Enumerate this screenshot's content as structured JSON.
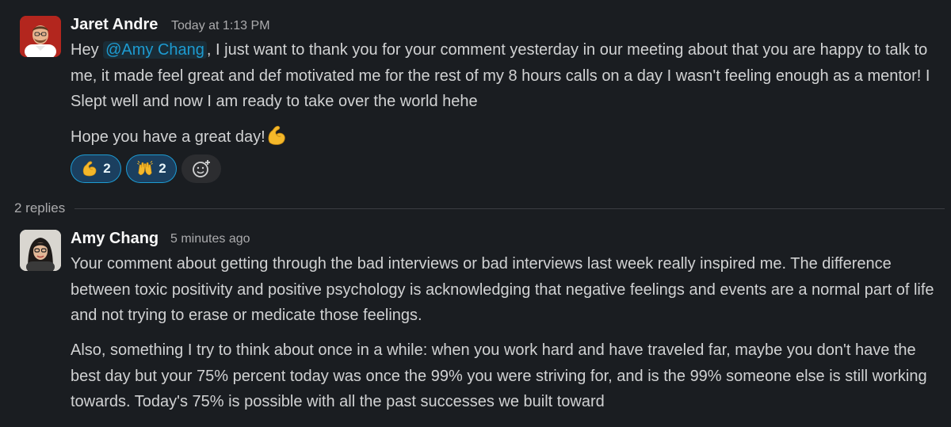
{
  "thread": {
    "parent": {
      "sender": "Jaret Andre",
      "timestamp": "Today at 1:13 PM",
      "avatar_icon": "user-avatar-man",
      "body": {
        "greeting": "Hey ",
        "mention": "@Amy Chang",
        "line1": ", I just want to thank you for your comment yesterday in our meeting about that you are happy to talk to me, it made feel great and def motivated me for the rest of my 8 hours calls on a day I wasn't feeling enough as a mentor! I Slept well and now I am ready to take over the world hehe",
        "line2": "Hope you have a great day!",
        "line2_emoji": "flexed-biceps"
      },
      "reactions": [
        {
          "emoji": "flexed-biceps",
          "count": "2"
        },
        {
          "emoji": "raising-hands",
          "count": "2"
        }
      ],
      "add_reaction_icon": "add-reaction-icon"
    },
    "replies_label": "2 replies",
    "reply": {
      "sender": "Amy Chang",
      "timestamp": "5 minutes ago",
      "avatar_icon": "user-avatar-woman",
      "paragraph1": "Your comment about getting through the bad interviews or bad interviews last week really inspired me. The difference between toxic positivity and positive psychology is acknowledging that negative feelings and events are a normal part of life and not trying to erase or medicate those feelings.",
      "paragraph2": "Also, something I try to think about once in a while: when you work hard and have traveled far, maybe you don't have the best day but your 75% percent today was once the 99% you were striving for, and is the 99% someone else is still working towards. Today's 75% is possible with all the past successes we built toward"
    }
  },
  "colors": {
    "background": "#1a1d21",
    "text": "#d1d2d3",
    "name": "#f8f8f8",
    "muted": "#ababad",
    "link": "#1d9bd1",
    "reaction_bg": "#1b3f5f"
  }
}
